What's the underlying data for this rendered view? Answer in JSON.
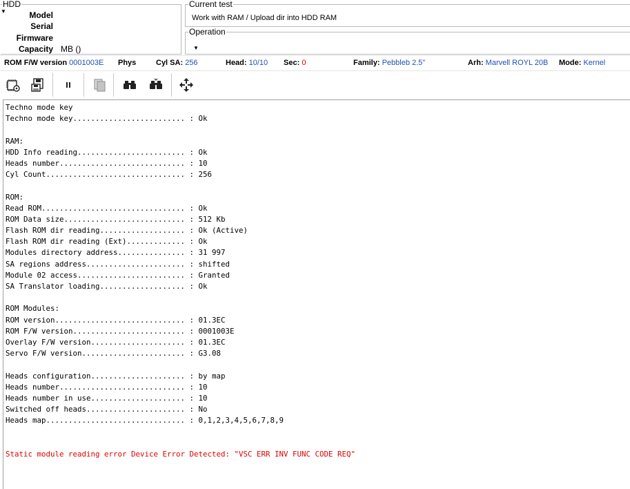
{
  "hdd": {
    "title": "HDD",
    "rows": [
      {
        "label": "Model",
        "value": ""
      },
      {
        "label": "Serial",
        "value": ""
      },
      {
        "label": "Firmware",
        "value": ""
      },
      {
        "label": "Capacity",
        "value": "MB ()"
      }
    ]
  },
  "current_test": {
    "title": "Current test",
    "value": "Work with RAM / Upload dir into HDD RAM"
  },
  "operation": {
    "title": "Operation",
    "value": ""
  },
  "status": {
    "rom_fw_label": "ROM F/W version",
    "rom_fw_value": "0001003E",
    "phys_label": "Phys",
    "cyl_sa_label": "Cyl SA:",
    "cyl_sa_value": "256",
    "head_label": "Head:",
    "head_value": "10/10",
    "sec_label": "Sec:",
    "sec_value": "0",
    "family_label": "Family:",
    "family_value": "Pebbleb 2.5\"",
    "arh_label": "Arh:",
    "arh_value": "Marvell ROYL 20B",
    "mode_label": "Mode:",
    "mode_value": "Kernel",
    "accent_color": "#1d4fb3",
    "error_color": "#e00000"
  },
  "toolbar": {
    "buttons": [
      {
        "icon": "chip-settings-icon"
      },
      {
        "icon": "save-disk-icon"
      },
      {
        "icon": "pause-icon"
      },
      {
        "icon": "copy-pages-icon"
      },
      {
        "icon": "binoculars-icon"
      },
      {
        "icon": "binoculars-next-icon"
      },
      {
        "icon": "move-arrows-icon"
      }
    ]
  },
  "log": {
    "lines": [
      "Techno mode key",
      "Techno mode key......................... : Ok",
      "",
      "RAM:",
      "HDD Info reading........................ : Ok",
      "Heads number............................ : 10",
      "Cyl Count............................... : 256",
      "",
      "ROM:",
      "Read ROM................................ : Ok",
      "ROM Data size........................... : 512 Kb",
      "Flash ROM dir reading................... : Ok (Active)",
      "Flash ROM dir reading (Ext)............. : Ok",
      "Modules directory address............... : 31 997",
      "SA regions address...................... : shifted",
      "Module 02 access........................ : Granted",
      "SA Translator loading................... : Ok",
      "",
      "ROM Modules:",
      "ROM version............................. : 01.3EC",
      "ROM F/W version......................... : 0001003E",
      "Overlay F/W version..................... : 01.3EC",
      "Servo F/W version....................... : G3.08",
      "",
      "Heads configuration..................... : by map",
      "Heads number............................ : 10",
      "Heads number in use..................... : 10",
      "Switched off heads...................... : No",
      "Heads map............................... : 0,1,2,3,4,5,6,7,8,9",
      "",
      "",
      "Static module reading error Device Error Detected: \"VSC ERR INV FUNC CODE REQ\""
    ],
    "error_line": "Static module reading error Device Error Detected: \"VSC ERR INV FUNC CODE REQ\""
  }
}
